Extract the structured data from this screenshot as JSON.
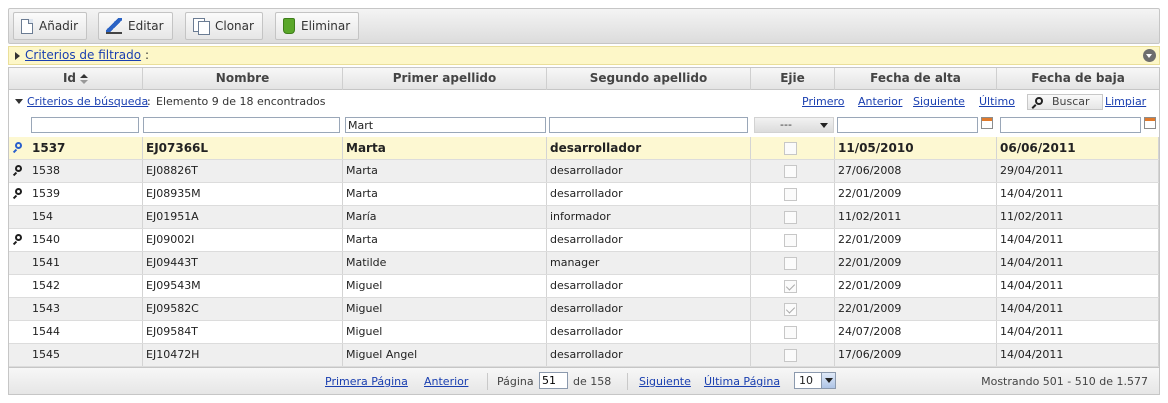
{
  "toolbar": {
    "add_label": "Añadir",
    "edit_label": "Editar",
    "clone_label": "Clonar",
    "delete_label": "Eliminar"
  },
  "filter_bar": {
    "link": "Criterios de filtrado",
    "suffix": ":"
  },
  "grid": {
    "columns": [
      "Id",
      "Nombre",
      "Primer apellido",
      "Segundo apellido",
      "Ejie",
      "Fecha de alta",
      "Fecha de baja"
    ],
    "search": {
      "criteria_link": "Criterios de búsqueda",
      "suffix": ":",
      "info": "Elemento 9 de 18 encontrados",
      "first": "Primero",
      "previous": "Anterior",
      "next": "Siguiente",
      "last": "Último",
      "search_button": "Buscar",
      "clear": "Limpiar"
    },
    "filters": {
      "id": "",
      "nombre": "",
      "apellido1": "Mart",
      "apellido2": "",
      "ejie": "---",
      "fecha_alta": "",
      "fecha_baja": ""
    },
    "rows": [
      {
        "id": "1537",
        "nombre": "EJ07366L",
        "apellido1": "Marta",
        "apellido2": "desarrollador",
        "ejie": false,
        "alta": "11/05/2010",
        "baja": "06/06/2011",
        "marker": "blue",
        "selected": true
      },
      {
        "id": "1538",
        "nombre": "EJ08826T",
        "apellido1": "Marta",
        "apellido2": "desarrollador",
        "ejie": false,
        "alta": "27/06/2008",
        "baja": "29/04/2011",
        "marker": "black",
        "selected": false
      },
      {
        "id": "1539",
        "nombre": "EJ08935M",
        "apellido1": "Marta",
        "apellido2": "desarrollador",
        "ejie": false,
        "alta": "22/01/2009",
        "baja": "14/04/2011",
        "marker": "black",
        "selected": false
      },
      {
        "id": "154",
        "nombre": "EJ01951A",
        "apellido1": "María",
        "apellido2": "informador",
        "ejie": false,
        "alta": "11/02/2011",
        "baja": "11/02/2011",
        "marker": "",
        "selected": false
      },
      {
        "id": "1540",
        "nombre": "EJ09002I",
        "apellido1": "Marta",
        "apellido2": "desarrollador",
        "ejie": false,
        "alta": "22/01/2009",
        "baja": "14/04/2011",
        "marker": "black",
        "selected": false
      },
      {
        "id": "1541",
        "nombre": "EJ09443T",
        "apellido1": "Matilde",
        "apellido2": "manager",
        "ejie": false,
        "alta": "22/01/2009",
        "baja": "14/04/2011",
        "marker": "",
        "selected": false
      },
      {
        "id": "1542",
        "nombre": "EJ09543M",
        "apellido1": "Miguel",
        "apellido2": "desarrollador",
        "ejie": true,
        "alta": "22/01/2009",
        "baja": "14/04/2011",
        "marker": "",
        "selected": false
      },
      {
        "id": "1543",
        "nombre": "EJ09582C",
        "apellido1": "Miguel",
        "apellido2": "desarrollador",
        "ejie": true,
        "alta": "22/01/2009",
        "baja": "14/04/2011",
        "marker": "",
        "selected": false
      },
      {
        "id": "1544",
        "nombre": "EJ09584T",
        "apellido1": "Miguel",
        "apellido2": "desarrollador",
        "ejie": false,
        "alta": "24/07/2008",
        "baja": "14/04/2011",
        "marker": "",
        "selected": false
      },
      {
        "id": "1545",
        "nombre": "EJ10472H",
        "apellido1": "Miguel Angel",
        "apellido2": "desarrollador",
        "ejie": false,
        "alta": "17/06/2009",
        "baja": "14/04/2011",
        "marker": "",
        "selected": false
      }
    ],
    "pager": {
      "first_page": "Primera Página",
      "previous": "Anterior",
      "page_label": "Página",
      "page_value": "51",
      "of_label": "de 158",
      "next": "Siguiente",
      "last_page": "Última Página",
      "page_size": "10",
      "showing": "Mostrando 501 - 510 de 1.577"
    }
  },
  "colors": {
    "selected_row": "#fdf8d2",
    "link": "#1a3fb0",
    "filter_bar": "#fdf7c8"
  }
}
